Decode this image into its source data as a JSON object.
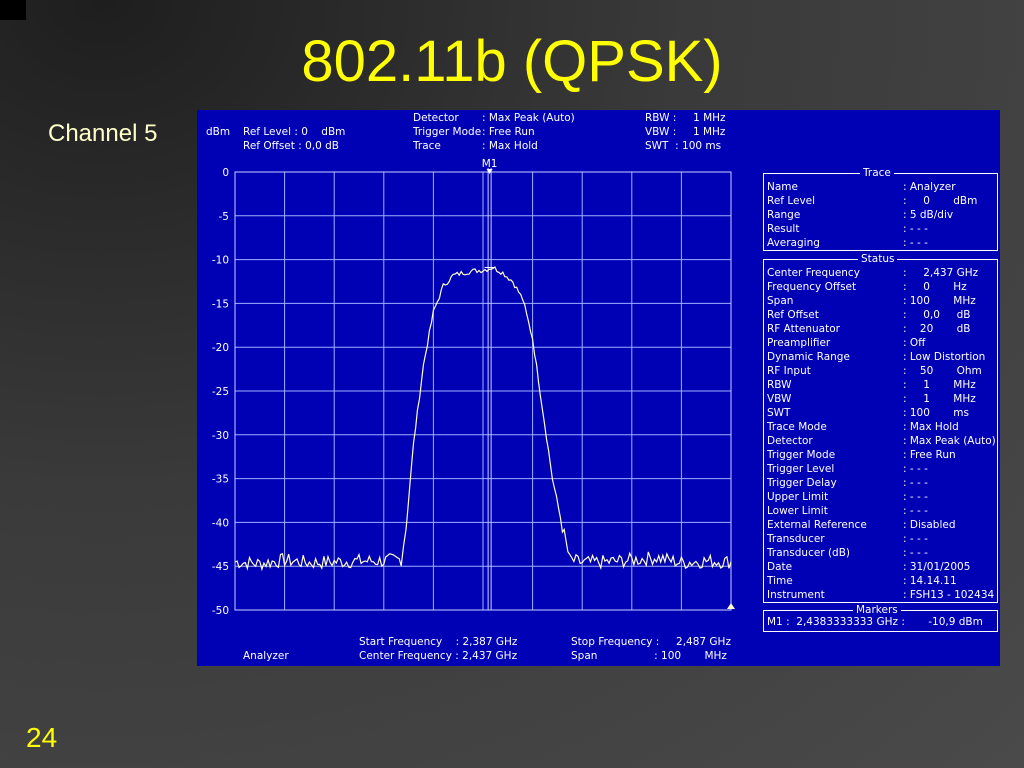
{
  "slide": {
    "title": "802.11b (QPSK)",
    "subtitle": "Channel 5",
    "page_number": "24"
  },
  "header": {
    "unit": "dBm",
    "ref_level": "Ref Level : 0    dBm",
    "ref_offset": "Ref Offset : 0,0 dB",
    "detector_label": "Detector",
    "detector_value": ": Max Peak (Auto)",
    "trigger_label": "Trigger Mode",
    "trigger_value": ": Free Run",
    "trace_label": "Trace",
    "trace_value": ": Max Hold",
    "rbw": "RBW :     1 MHz",
    "vbw": "VBW :     1 MHz",
    "swt": "SWT  : 100 ms"
  },
  "marker_label": "M1",
  "trace_panel": {
    "title": "Trace",
    "rows": [
      {
        "label": "Name",
        "value": ": Analyzer"
      },
      {
        "label": "Ref Level",
        "value": ":     0       dBm"
      },
      {
        "label": "Range",
        "value": ": 5 dB/div"
      },
      {
        "label": "Result",
        "value": ": - - -"
      },
      {
        "label": "Averaging",
        "value": ": - - -"
      }
    ]
  },
  "status_panel": {
    "title": "Status",
    "rows": [
      {
        "label": "Center Frequency",
        "value": ":     2,437 GHz"
      },
      {
        "label": "Frequency Offset",
        "value": ":     0       Hz"
      },
      {
        "label": "Span",
        "value": ": 100       MHz"
      },
      {
        "label": "Ref Offset",
        "value": ":     0,0     dB"
      },
      {
        "label": "RF Attenuator",
        "value": ":    20       dB"
      },
      {
        "label": "Preamplifier",
        "value": ": Off"
      },
      {
        "label": "Dynamic Range",
        "value": ": Low Distortion"
      },
      {
        "label": "RF Input",
        "value": ":    50       Ohm"
      },
      {
        "label": "RBW",
        "value": ":     1       MHz"
      },
      {
        "label": "VBW",
        "value": ":     1       MHz"
      },
      {
        "label": "SWT",
        "value": ": 100       ms"
      },
      {
        "label": "Trace Mode",
        "value": ": Max Hold"
      },
      {
        "label": "Detector",
        "value": ": Max Peak (Auto)"
      },
      {
        "label": "Trigger Mode",
        "value": ": Free Run"
      },
      {
        "label": "Trigger Level",
        "value": ": - - -"
      },
      {
        "label": "Trigger Delay",
        "value": ": - - -"
      },
      {
        "label": "Upper Limit",
        "value": ": - - -"
      },
      {
        "label": "Lower Limit",
        "value": ": - - -"
      },
      {
        "label": "External Reference",
        "value": ": Disabled"
      },
      {
        "label": "Transducer",
        "value": ": - - -"
      },
      {
        "label": "Transducer (dB)",
        "value": ": - - -"
      },
      {
        "label": "Date",
        "value": ": 31/01/2005"
      },
      {
        "label": "Time",
        "value": ": 14.14.11"
      },
      {
        "label": "Instrument",
        "value": ": FSH13 - 102434"
      }
    ]
  },
  "markers_panel": {
    "title": "Markers",
    "m1": "M1 :  2,4383333333 GHz :       -10,9 dBm"
  },
  "footer": {
    "mode": "Analyzer",
    "start": "Start Frequency    : 2,387 GHz",
    "center": "Center Frequency : 2,437 GHz",
    "stop": "Stop Frequency :     2,487 GHz",
    "span": "Span                 : 100       MHz"
  },
  "colors": {
    "screen": "#0000b4",
    "title": "#ffff00",
    "trace": "#ffffcc",
    "grid": "#9fb0ff"
  },
  "chart_data": {
    "type": "line",
    "xlabel": "",
    "ylabel": "dBm",
    "xlim": [
      2.387,
      2.487
    ],
    "ylim": [
      -50,
      0
    ],
    "yticks": [
      0,
      -5,
      -10,
      -15,
      -20,
      -25,
      -30,
      -35,
      -40,
      -45,
      -50
    ],
    "grid": true,
    "marker": {
      "name": "M1",
      "x": 2.4383333333,
      "y": -10.9
    },
    "series": [
      {
        "x": [
          2.387,
          2.392,
          2.397,
          2.402,
          2.407,
          2.412,
          2.417,
          2.4205,
          2.4215,
          2.423,
          2.425,
          2.427,
          2.429,
          2.431,
          2.433,
          2.435,
          2.437,
          2.439,
          2.441,
          2.443,
          2.445,
          2.447,
          2.449,
          2.451,
          2.453,
          2.4545,
          2.457,
          2.462,
          2.467,
          2.472,
          2.477,
          2.482,
          2.487
        ],
        "y": [
          -44.5,
          -44.7,
          -44.3,
          -44.6,
          -44.5,
          -44.4,
          -44.4,
          -44.2,
          -40.5,
          -31,
          -22,
          -16,
          -13,
          -11.8,
          -11.5,
          -11.3,
          -11.2,
          -10.9,
          -11.5,
          -12.5,
          -14.5,
          -19,
          -27,
          -35,
          -40.5,
          -44.3,
          -44.6,
          -44.5,
          -44.3,
          -44.0,
          -44.6,
          -44.4,
          -44.5
        ]
      }
    ]
  }
}
